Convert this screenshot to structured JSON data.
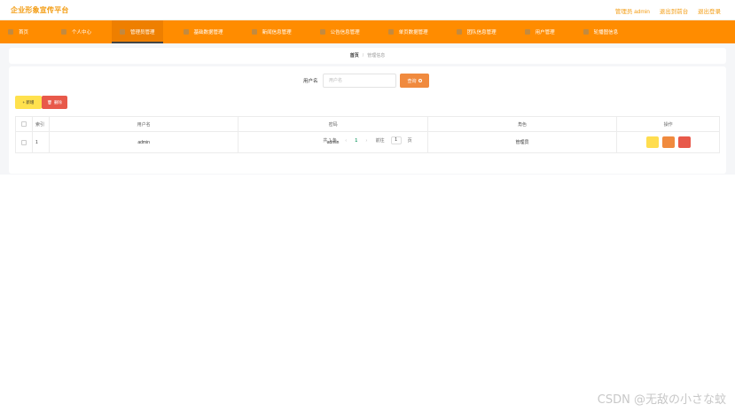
{
  "header": {
    "title": "企业形象宣传平台",
    "links": [
      "管理员 admin",
      "退出到前台",
      "退出登录"
    ]
  },
  "nav": {
    "items": [
      {
        "label": "首页",
        "icon": "home-icon"
      },
      {
        "label": "个人中心",
        "icon": "user-icon"
      },
      {
        "label": "管理员管理",
        "icon": "admin-icon",
        "active": true
      },
      {
        "label": "基础数据管理",
        "icon": "database-icon"
      },
      {
        "label": "新闻信息管理",
        "icon": "news-icon"
      },
      {
        "label": "公告信息管理",
        "icon": "notice-icon"
      },
      {
        "label": "单页数据管理",
        "icon": "page-icon"
      },
      {
        "label": "团队信息管理",
        "icon": "team-icon"
      },
      {
        "label": "用户管理",
        "icon": "users-icon"
      },
      {
        "label": "轮播图信息",
        "icon": "carousel-icon"
      }
    ]
  },
  "breadcrumb": {
    "home": "首页",
    "separator": "/",
    "current": "管理信息"
  },
  "search": {
    "label": "用户名",
    "placeholder": "用户名",
    "button": "查询"
  },
  "actions": {
    "add": "+ 新增",
    "delete": "删除"
  },
  "table": {
    "columns": [
      "索引",
      "用户名",
      "密码",
      "角色",
      "操作"
    ],
    "rows": [
      {
        "index": "1",
        "username": "admin",
        "password": "admin",
        "role": "管理员"
      }
    ]
  },
  "pagination": {
    "total": "共 1 条",
    "prev": "‹",
    "current": "1",
    "next": "›",
    "goto": "前往",
    "page_value": "1",
    "page_suffix": "页"
  },
  "watermark": "CSDN @无敌の小さな蚊",
  "colors": {
    "accent": "#ff8c00",
    "brand_text": "#f39c12",
    "search_button": "#f08a3e",
    "add_button": "#ffe14d",
    "delete_button": "#e8594a"
  }
}
